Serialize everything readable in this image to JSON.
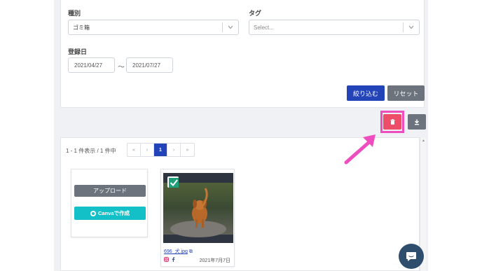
{
  "filters": {
    "category_label": "種別",
    "category_value": "ゴミ箱",
    "tag_label": "タグ",
    "tag_placeholder": "Select...",
    "date_label": "登録日",
    "date_from": "2021/04/27",
    "date_separator": "〜",
    "date_to": "2021/07/27",
    "apply_button": "絞り込む",
    "reset_button": "リセット"
  },
  "toolbar": {
    "delete_icon": "trash-icon",
    "download_icon": "download-icon"
  },
  "list": {
    "count_text": "1 - 1 件表示 / 1 件中",
    "pagination": {
      "first": "«",
      "prev": "‹",
      "current": "1",
      "next": "›",
      "last": "»"
    },
    "upload_button": "アップロード",
    "canva_button": "Canvaで作成",
    "items": [
      {
        "filename": "696_犬.jpg",
        "date": "2021年7月7日",
        "selected": true
      }
    ]
  },
  "colors": {
    "primary": "#2343b8",
    "danger": "#ee4d6a",
    "secondary": "#6c737d",
    "canva": "#13c0c8",
    "highlight": "#ee4dbd"
  }
}
